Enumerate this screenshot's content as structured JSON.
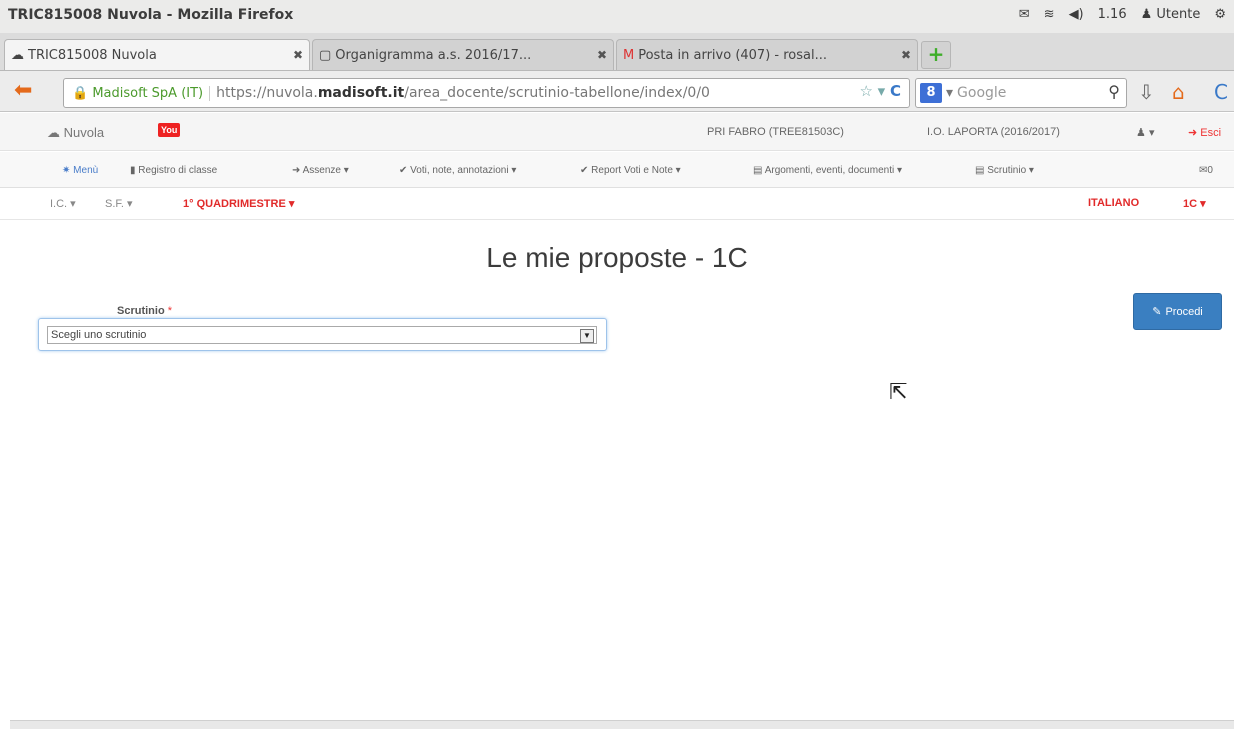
{
  "window": {
    "title": "TRIC815008 Nuvola - Mozilla Firefox",
    "tray": {
      "mail_icon": "mail-icon",
      "wifi_icon": "wifi-icon",
      "volume": "◀)",
      "time": "1.16",
      "user": "Utente",
      "power_icon": "power-icon"
    }
  },
  "tabs": [
    {
      "label": "TRIC815008 Nuvola",
      "icon": "cloud-icon",
      "close": "✖"
    },
    {
      "label": "Organigramma a.s. 2016/17...",
      "icon": "document-icon",
      "close": "✖"
    },
    {
      "label": "Posta in arrivo (407) - rosal...",
      "icon": "gmail-icon",
      "close": "✖"
    }
  ],
  "nav": {
    "identity": "Madisoft SpA (IT)",
    "url_prefix": "https://nuvola.",
    "url_domain": "madisoft.it",
    "url_path": "/area_docente/scrutinio-tabellone/index/0/0",
    "search_placeholder": "Google",
    "search_engine_letter": "8"
  },
  "header": {
    "brand": "Nuvola",
    "youtube": "You",
    "school": "PRI FABRO (TREE81503C)",
    "institute": "I.O. LAPORTA (2016/2017)",
    "user_menu": "▾",
    "logout": "Esci"
  },
  "menu": {
    "items": [
      "Menù",
      "Registro di classe",
      "Assenze ▾",
      "Voti, note, annotazioni ▾",
      "Report Voti e Note ▾",
      "Argomenti, eventi, documenti ▾",
      "Scrutinio ▾"
    ],
    "messages": "0"
  },
  "filter": {
    "ic": "I.C. ▾",
    "sf": "S.F. ▾",
    "period": "1° QUADRIMESTRE ▾",
    "subject": "ITALIANO",
    "class": "1C ▾"
  },
  "page": {
    "title": "Le mie proposte - 1C",
    "select_label": "Scrutinio",
    "required_mark": "*",
    "select_value": "Scegli uno scrutinio",
    "button": "Procedi"
  }
}
